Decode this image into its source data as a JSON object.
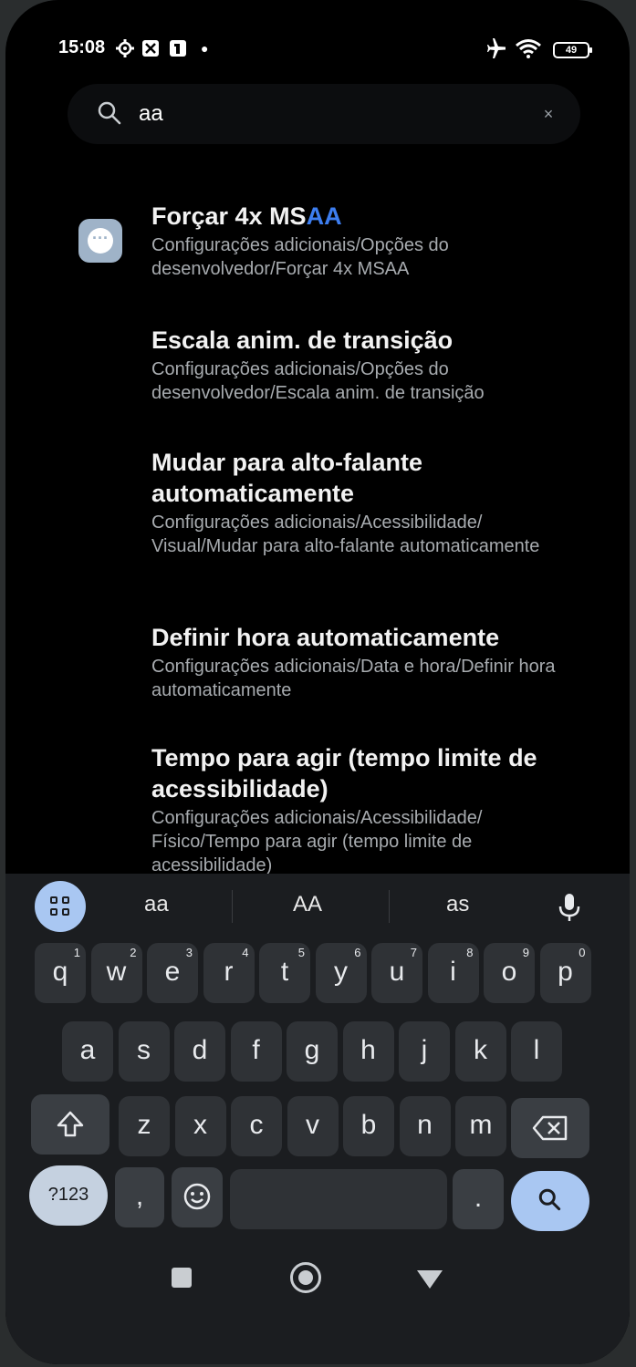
{
  "status_bar": {
    "time": "15:08",
    "battery": "49",
    "icons": [
      "settings-icon",
      "puzzle-icon",
      "notification-icon",
      "dot-icon",
      "airplane-icon",
      "wifi-icon",
      "battery-icon"
    ]
  },
  "search": {
    "query": "aa",
    "clear_label": "×"
  },
  "results": [
    {
      "title_prefix": "Forçar 4x MS",
      "title_highlight": "AA",
      "path": "Configurações adicionais/Opções do desenvolvedor/Forçar 4x MSAA"
    },
    {
      "title": "Escala anim. de transição",
      "path": "Configurações adicionais/Opções do desenvolvedor/Escala anim. de transição"
    },
    {
      "title": "Mudar para alto-falante automaticamente",
      "path": "Configurações adicionais/Acessibilidade/ Visual/Mudar para alto-falante automaticamente"
    },
    {
      "title": "Definir hora automaticamente",
      "path": "Configurações adicionais/Data e hora/Definir hora automaticamente"
    },
    {
      "title": "Tempo para agir (tempo limite de acessibilidade)",
      "path": "Configurações adicionais/Acessibilidade/ Físico/Tempo para agir (tempo limite de acessibilidade)"
    }
  ],
  "keyboard": {
    "suggestions": [
      "aa",
      "AA",
      "as"
    ],
    "row1": [
      {
        "k": "q",
        "n": "1"
      },
      {
        "k": "w",
        "n": "2"
      },
      {
        "k": "e",
        "n": "3"
      },
      {
        "k": "r",
        "n": "4"
      },
      {
        "k": "t",
        "n": "5"
      },
      {
        "k": "y",
        "n": "6"
      },
      {
        "k": "u",
        "n": "7"
      },
      {
        "k": "i",
        "n": "8"
      },
      {
        "k": "o",
        "n": "9"
      },
      {
        "k": "p",
        "n": "0"
      }
    ],
    "row2": [
      "a",
      "s",
      "d",
      "f",
      "g",
      "h",
      "j",
      "k",
      "l"
    ],
    "row3": [
      "z",
      "x",
      "c",
      "v",
      "b",
      "n",
      "m"
    ],
    "sym_label": "?123",
    "comma": ",",
    "period": ".",
    "accent_color": "#a9c7f2",
    "highlight_color": "#3d7ef0"
  }
}
